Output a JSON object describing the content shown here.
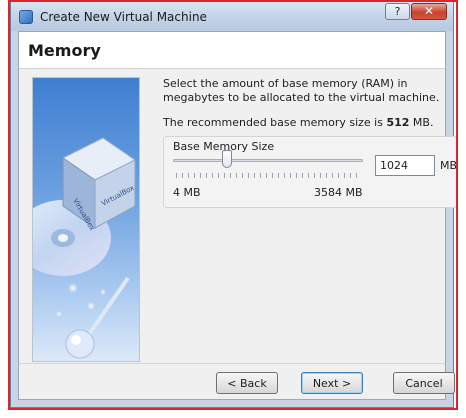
{
  "window": {
    "title": "Create New Virtual Machine"
  },
  "title_buttons": {
    "help": "?",
    "close": "✕"
  },
  "page": {
    "title": "Memory",
    "description": "Select the amount of base memory (RAM) in megabytes to be allocated to the virtual machine.",
    "recommended_prefix": "The recommended base memory size is ",
    "recommended_value": "512",
    "recommended_suffix": " MB."
  },
  "memory": {
    "group_label": "Base Memory Size",
    "value": "1024",
    "unit": "MB",
    "min_label": "4 MB",
    "max_label": "3584 MB",
    "slider_level_fraction": 0.285
  },
  "buttons": {
    "back": "< Back",
    "next": "Next >",
    "cancel": "Cancel"
  },
  "icons": [
    "virtualbox-icon",
    "help-icon",
    "close-icon",
    "virtualbox-logo-illustration"
  ],
  "colors": {
    "title_bar": "#c4d4e8",
    "close_button": "#c7432c",
    "dialog_bg": "#f0f0f0"
  }
}
